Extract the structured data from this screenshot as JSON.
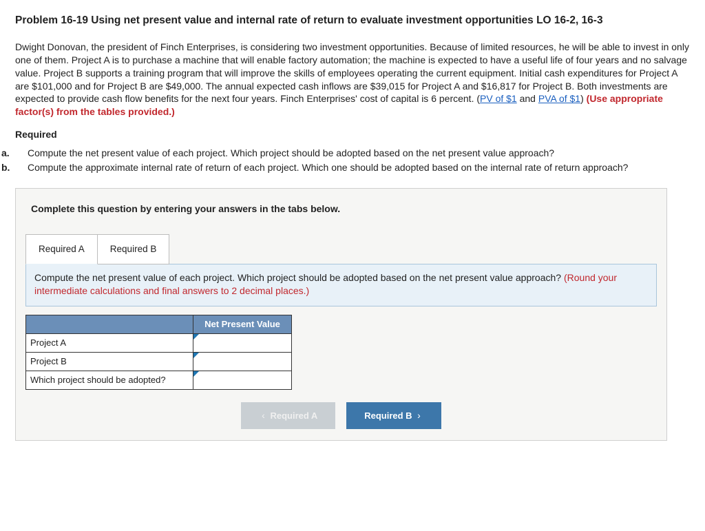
{
  "title": "Problem 16-19 Using net present value and internal rate of return to evaluate investment opportunities LO 16-2, 16-3",
  "body_pre": "Dwight Donovan, the president of Finch Enterprises, is considering two investment opportunities. Because of limited resources, he will be able to invest in only one of them. Project A is to purchase a machine that will enable factory automation; the machine is expected to have a useful life of four years and no salvage value. Project B supports a training program that will improve the skills of employees operating the current equipment. Initial cash expenditures for Project A are $101,000 and for Project B are $49,000. The annual expected cash inflows are $39,015 for Project A and $16,817 for Project B. Both investments are expected to provide cash flow benefits for the next four years. Finch Enterprises' cost of capital is 6 percent. (",
  "link1": "PV of $1",
  "body_mid": " and ",
  "link2": "PVA of $1",
  "body_close_paren": ") ",
  "body_red": "(Use appropriate factor(s) from the tables provided.)",
  "required_head": "Required",
  "req_a": "Compute the net present value of each project. Which project should be adopted based on the net present value approach?",
  "req_b": "Compute the approximate internal rate of return of each project. Which one should be adopted based on the internal rate of return approach?",
  "instruction": "Complete this question by entering your answers in the tabs below.",
  "tabA": "Required A",
  "tabB": "Required B",
  "prompt_main": "Compute the net present value of each project. Which project should be adopted based on the net present value approach? ",
  "prompt_note": "(Round your intermediate calculations and final answers to 2 decimal places.)",
  "col_header": "Net Present Value",
  "row1": "Project A",
  "row2": "Project B",
  "row3": "Which project should be adopted?",
  "nav_prev": "Required A",
  "nav_next": "Required B"
}
